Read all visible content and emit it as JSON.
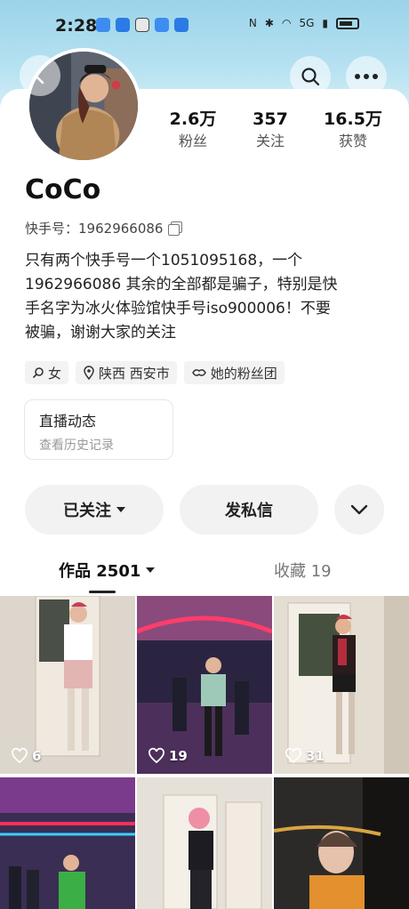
{
  "status_bar": {
    "time": "2:28",
    "network": "5G"
  },
  "header": {
    "back_icon": "back-arrow-icon",
    "search_icon": "search-icon",
    "more_icon": "more-dots-icon"
  },
  "profile": {
    "name": "CoCo",
    "kuaishou_id_label": "快手号：",
    "kuaishou_id": "1962966086",
    "bio_lines": [
      "只有两个快手号一个1051095168，一个",
      "1962966086 其余的全部都是骗子，特别是快",
      "手名字为冰火体验馆快手号iso900006！不要",
      "被骗，谢谢大家的关注"
    ],
    "stats": [
      {
        "num": "2.6万",
        "label": "粉丝"
      },
      {
        "num": "357",
        "label": "关注"
      },
      {
        "num": "16.5万",
        "label": "获赞"
      }
    ],
    "tags": [
      {
        "icon": "female-icon",
        "text": "女"
      },
      {
        "icon": "location-icon",
        "text": "陕西 西安市"
      },
      {
        "icon": "fan-club-icon",
        "text": "她的粉丝团"
      }
    ]
  },
  "live": {
    "title": "直播动态",
    "subtitle": "查看历史记录"
  },
  "actions": {
    "follow_label": "已关注",
    "message_label": "发私信",
    "dropdown_icon": "chevron-down-icon"
  },
  "tabs": {
    "works_label": "作品 2501",
    "favorites_label": "收藏 19"
  },
  "grid": [
    {
      "likes": "6"
    },
    {
      "likes": "19"
    },
    {
      "likes": "31"
    },
    {
      "likes": ""
    },
    {
      "likes": ""
    },
    {
      "likes": ""
    }
  ]
}
